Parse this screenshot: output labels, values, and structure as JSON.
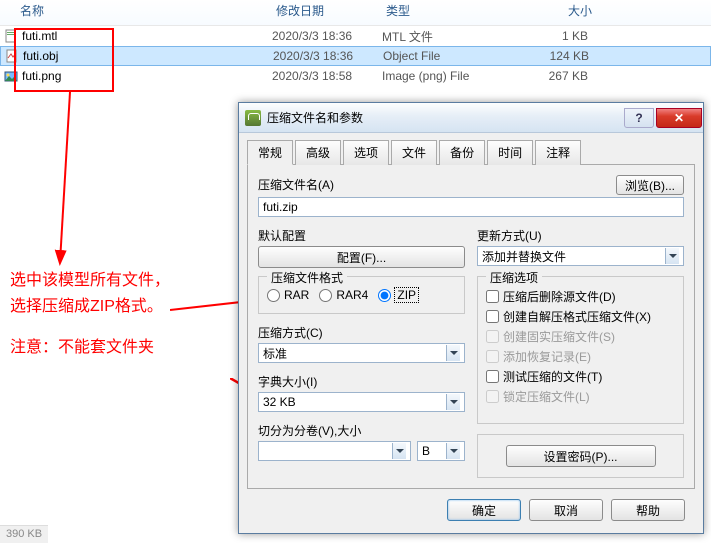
{
  "explorer": {
    "headers": {
      "name": "名称",
      "date": "修改日期",
      "type": "类型",
      "size": "大小"
    },
    "files": [
      {
        "name": "futi.mtl",
        "date": "2020/3/3 18:36",
        "type": "MTL 文件",
        "size": "1 KB"
      },
      {
        "name": "futi.obj",
        "date": "2020/3/3 18:36",
        "type": "Object File",
        "size": "124 KB"
      },
      {
        "name": "futi.png",
        "date": "2020/3/3 18:58",
        "type": "Image (png) File",
        "size": "267 KB"
      }
    ]
  },
  "annotation": {
    "line1": "选中该模型所有文件，",
    "line2": "选择压缩成ZIP格式。",
    "line3": "注意：不能套文件夹"
  },
  "dialog": {
    "title": "压缩文件名和参数",
    "help_icon": "?",
    "close_icon": "✕",
    "tabs": [
      "常规",
      "高级",
      "选项",
      "文件",
      "备份",
      "时间",
      "注释"
    ],
    "archive_name_label": "压缩文件名(A)",
    "archive_name_value": "futi.zip",
    "browse_btn": "浏览(B)...",
    "profile_label": "默认配置",
    "profile_btn": "配置(F)...",
    "update_label": "更新方式(U)",
    "update_value": "添加并替换文件",
    "format_label": "压缩文件格式",
    "formats": {
      "rar": "RAR",
      "rar4": "RAR4",
      "zip": "ZIP"
    },
    "method_label": "压缩方式(C)",
    "method_value": "标准",
    "dict_label": "字典大小(I)",
    "dict_value": "32 KB",
    "split_label": "切分为分卷(V),大小",
    "split_value": "",
    "split_unit": "B",
    "options_label": "压缩选项",
    "opts": {
      "delete": "压缩后删除源文件(D)",
      "sfx": "创建自解压格式压缩文件(X)",
      "solid": "创建固实压缩文件(S)",
      "recovery": "添加恢复记录(E)",
      "test": "测试压缩的文件(T)",
      "lock": "锁定压缩文件(L)"
    },
    "password_btn": "设置密码(P)...",
    "ok": "确定",
    "cancel": "取消",
    "help": "帮助"
  },
  "status": "390 KB"
}
